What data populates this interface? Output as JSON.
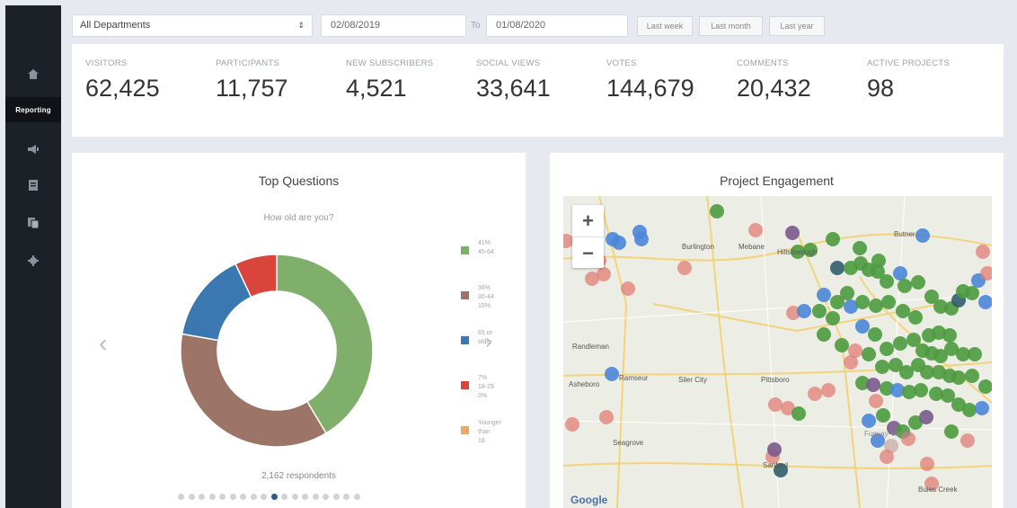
{
  "filters": {
    "department": "All Departments",
    "date_from": "02/08/2019",
    "to_label": "To",
    "date_to": "01/08/2020",
    "ranges": [
      "Last week",
      "Last month",
      "Last year"
    ]
  },
  "sidebar": {
    "items": [
      {
        "icon": "home-icon"
      },
      {
        "label": "Reporting"
      },
      {
        "icon": "megaphone-icon"
      },
      {
        "icon": "document-icon"
      },
      {
        "icon": "pages-icon"
      },
      {
        "icon": "gear-icon"
      }
    ]
  },
  "stats": [
    {
      "label": "VISITORS",
      "value": "62,425"
    },
    {
      "label": "PARTICIPANTS",
      "value": "11,757"
    },
    {
      "label": "NEW SUBSCRIBERS",
      "value": "4,521"
    },
    {
      "label": "SOCIAL VIEWS",
      "value": "33,641"
    },
    {
      "label": "VOTES",
      "value": "144,679"
    },
    {
      "label": "COMMENTS",
      "value": "20,432"
    },
    {
      "label": "ACTIVE PROJECTS",
      "value": "98"
    }
  ],
  "top_questions": {
    "title": "Top Questions",
    "question": "How old are you?",
    "respondents": "2,162 respondents",
    "pager_count": 18,
    "pager_active_index": 9,
    "legend": [
      {
        "line1": "41%",
        "line2": "45-64",
        "line3": "",
        "color": "#7faf6a"
      },
      {
        "line1": "36%",
        "line2": "30-44",
        "line3": "15%",
        "color": "#9c7468"
      },
      {
        "line1": "65 or",
        "line2": "older",
        "line3": "",
        "color": "#3b77b0"
      },
      {
        "line1": "7%",
        "line2": "18-29",
        "line3": "0%",
        "color": "#d9453a"
      },
      {
        "line1": "Younger",
        "line2": "than",
        "line3": "18",
        "color": "#e8a868"
      }
    ]
  },
  "chart_data": {
    "type": "pie",
    "title": "How old are you?",
    "categories": [
      "45-64",
      "30-44",
      "65 or older",
      "18-29",
      "Younger than 18"
    ],
    "values": [
      41,
      36,
      15,
      7,
      0
    ],
    "colors": [
      "#7faf6a",
      "#9c7468",
      "#3b77b0",
      "#d9453a",
      "#e8a868"
    ]
  },
  "project_engagement": {
    "title": "Project Engagement",
    "zoom_in": "+",
    "zoom_out": "−",
    "labels": [
      "Burlington",
      "Mebane",
      "Hillsborough",
      "Butner",
      "Randleman",
      "Ramseur",
      "Siler City",
      "Pittsboro",
      "Asheboro",
      "Seagrove",
      "Sanford",
      "Fuquay-Varina",
      "Buies Creek"
    ],
    "attribution": "Google"
  }
}
